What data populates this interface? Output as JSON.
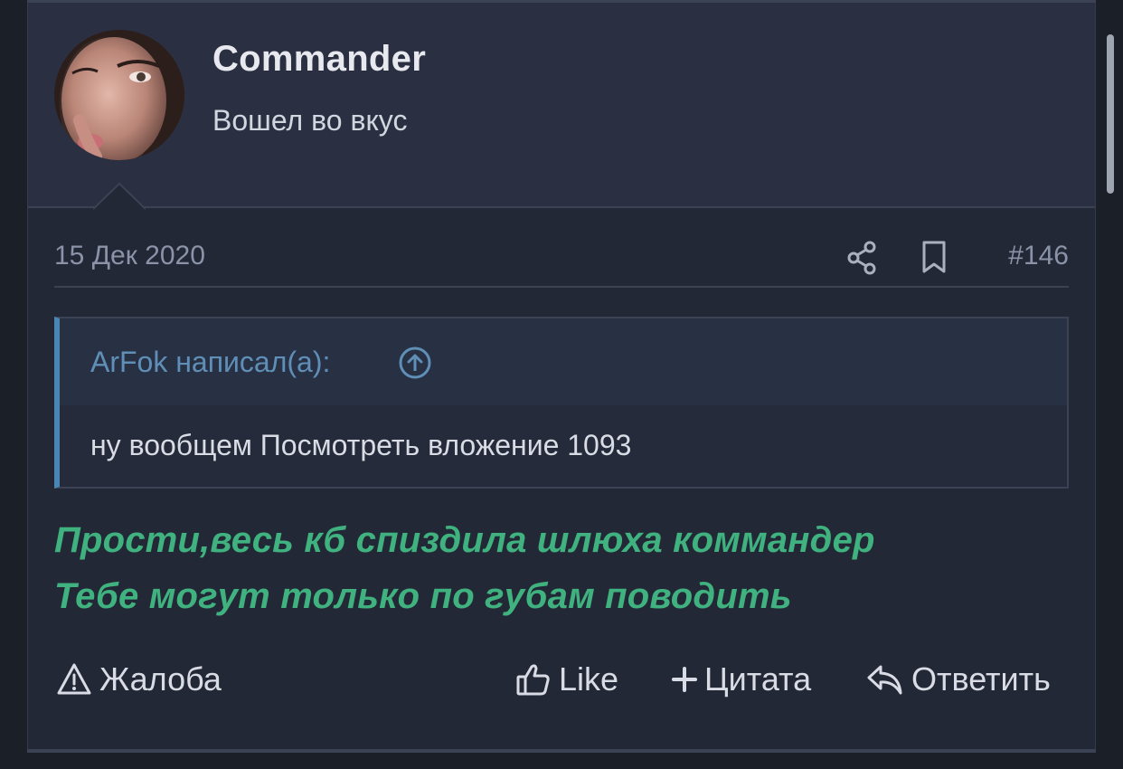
{
  "post": {
    "author": {
      "name": "Commander",
      "title": "Вошел во вкус"
    },
    "date": "15 Дек 2020",
    "number": "#146",
    "quote": {
      "author_line": "ArFok написал(а):",
      "text": "ну вообщем Посмотреть вложение 1093"
    },
    "message_lines": [
      "Прости,весь кб спиздила шлюха коммандер",
      "Тебе могут только по губам поводить"
    ],
    "actions": {
      "report": "Жалоба",
      "like": "Like",
      "quote": "Цитата",
      "reply": "Ответить"
    }
  },
  "icons": {
    "meta": [
      "share-icon",
      "bookmark-icon"
    ],
    "quote": "arrow-up-circle-icon",
    "report": "warning-triangle-icon",
    "like": "thumbs-up-icon",
    "quote_action": "plus-icon",
    "reply": "reply-arrow-icon"
  },
  "colors": {
    "background": "#232836",
    "header_bg": "#2a3042",
    "accent_text": "#3fb27f",
    "quote_border": "#4a86b4",
    "quote_author": "#5f8fb6",
    "muted": "#8a93a7"
  }
}
